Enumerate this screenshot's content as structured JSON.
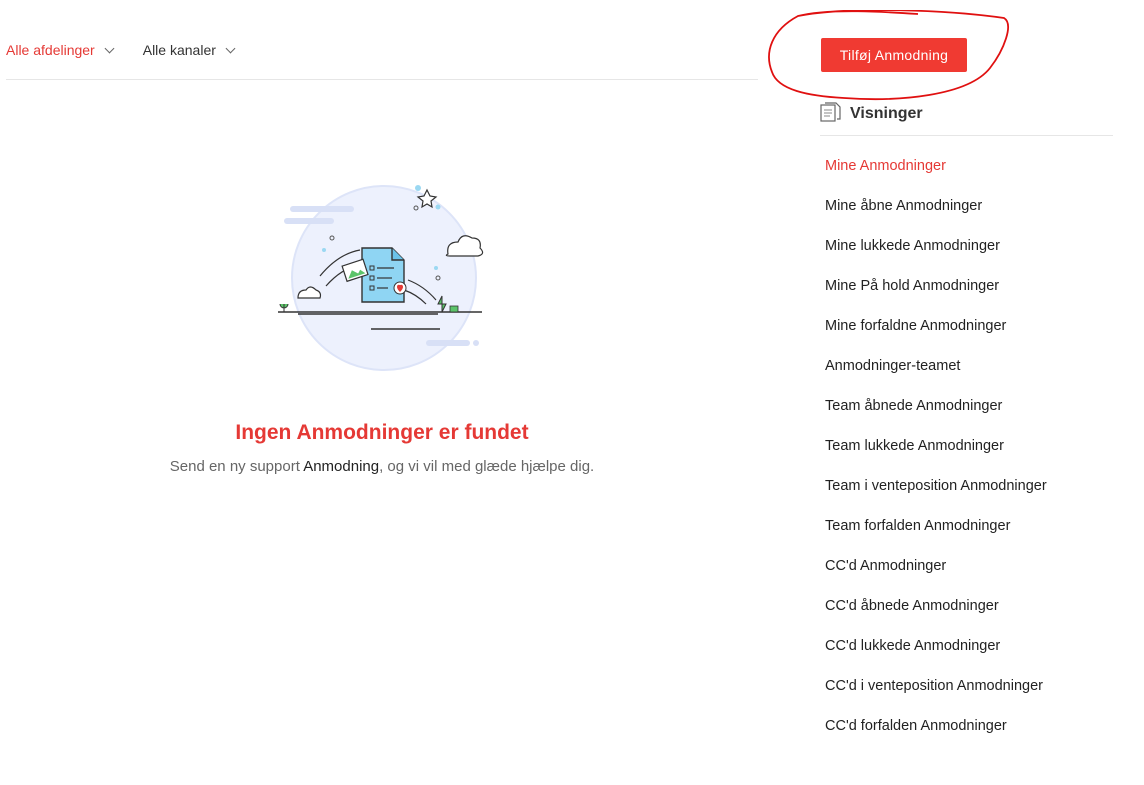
{
  "filters": [
    {
      "label": "Alle afdelinger",
      "active": true
    },
    {
      "label": "Alle kanaler",
      "active": false
    }
  ],
  "empty_state": {
    "title": "Ingen Anmodninger er fundet",
    "subtitle_prefix": "Send en ny support ",
    "subtitle_link": "Anmodning",
    "subtitle_suffix": ", og vi vil med glæde hjælpe dig.",
    "illustration": "document-upload-illustration"
  },
  "sidebar": {
    "add_button": "Tilføj Anmodning",
    "views_title": "Visninger",
    "views_icon": "document-list-icon",
    "views": [
      "Mine Anmodninger",
      "Mine åbne Anmodninger",
      "Mine lukkede Anmodninger",
      "Mine På hold Anmodninger",
      "Mine forfaldne Anmodninger",
      "Anmodninger-teamet",
      "Team åbnede Anmodninger",
      "Team lukkede Anmodninger",
      "Team i venteposition Anmodninger",
      "Team forfalden Anmodninger",
      "CC'd Anmodninger",
      "CC'd åbnede Anmodninger",
      "CC'd lukkede Anmodninger",
      "CC'd i venteposition Anmodninger",
      "CC'd forfalden Anmodninger"
    ],
    "active_view": 0
  },
  "colors": {
    "accent": "#e53935",
    "button": "#f03a32",
    "annotation": "#e01010"
  }
}
